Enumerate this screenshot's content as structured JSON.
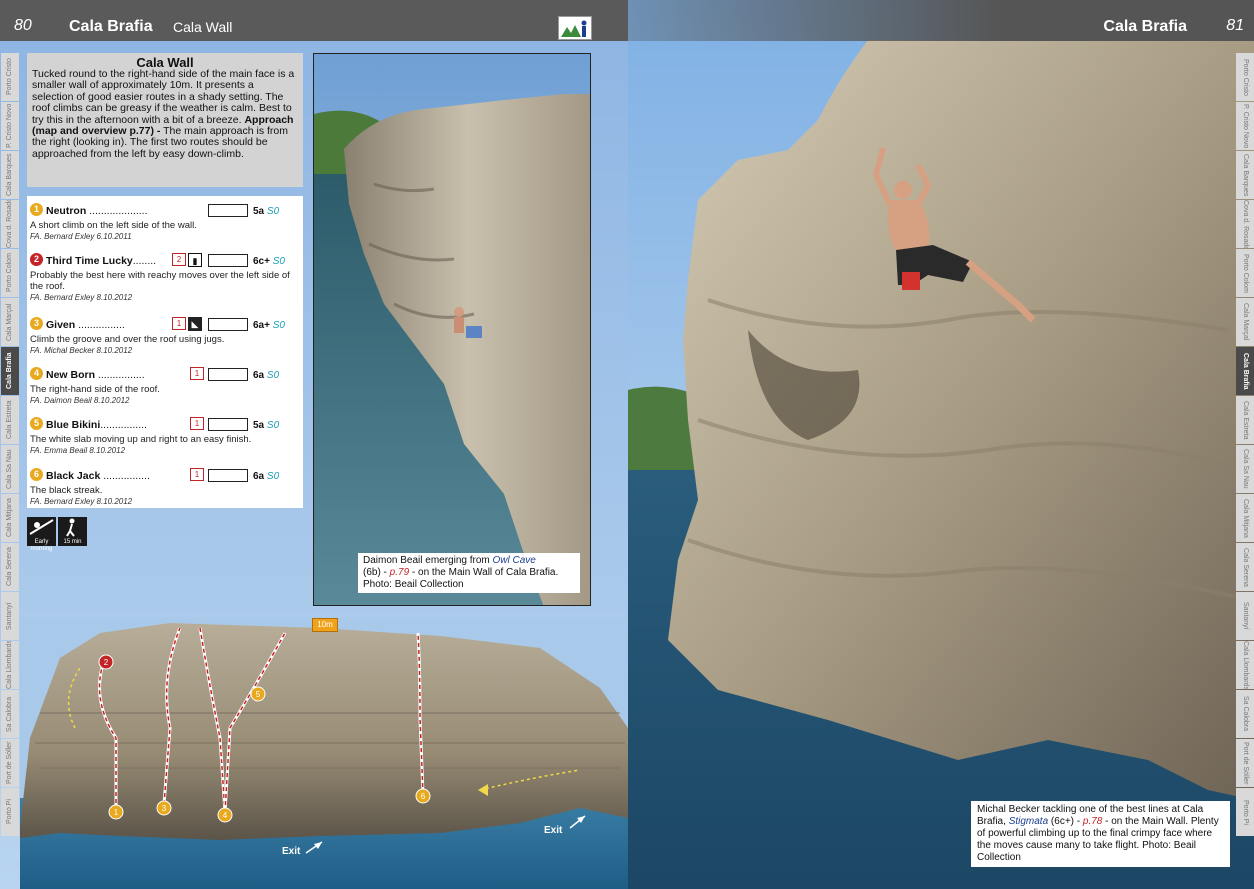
{
  "header": {
    "left_page_number": "80",
    "left_title": "Cala Brafia",
    "left_subtitle": "Cala Wall",
    "right_title": "Cala Brafia",
    "right_page_number": "81"
  },
  "thumb_tabs": [
    "Porto Cristo",
    "P. Cristo Novo",
    "Cala Barques",
    "Cova d. Rosador",
    "Porto Colom",
    "Cala Marçal",
    "Cala Brafia",
    "Cala Estreta",
    "Cala Sa Nau",
    "Cala Mitjana",
    "Cala Serena",
    "Santanyí",
    "Cala Llombards",
    "Sa Calobra",
    "Port de Sóller",
    "Porto Pi"
  ],
  "active_tab": "Cala Brafia",
  "intro": {
    "heading": "Cala Wall",
    "body": "Tucked round to the right-hand side of the main face is a smaller wall of approximately 10m. It presents a selection of good easier routes in a shady setting. The roof climbs can be greasy if the weather is calm. Best to try this in the afternoon with a bit of a breeze.",
    "approach_label": "Approach (map and overview p.77) -",
    "approach_text": " The main approach is from the right (looking in). The first two routes should be approached from the left by easy down-climb."
  },
  "routes": [
    {
      "num": "1",
      "name": "Neutron",
      "dots": " ....................",
      "grade": "5a",
      "s_grade": "S0",
      "desc": "A short climb on the left side of the wall.",
      "fa": "FA. Bernard Exley 6.10.2011"
    },
    {
      "num": "2",
      "name": "Third Time Lucky",
      "dots": "........",
      "grade": "6c+",
      "s_grade": "S0",
      "desc": "Probably the best here with reachy moves over the left side of the roof.",
      "fa": "FA. Bernard Exley 8.10.2012"
    },
    {
      "num": "3",
      "name": "Given",
      "dots": " ................",
      "grade": "6a+",
      "s_grade": "S0",
      "desc": "Climb the groove and over the roof using jugs.",
      "fa": "FA. Michal Becker 8.10.2012"
    },
    {
      "num": "4",
      "name": "New Born",
      "dots": " ................",
      "grade": "6a",
      "s_grade": "S0",
      "desc": "The right-hand side of the roof.",
      "fa": "FA. Daimon Beail 8.10.2012"
    },
    {
      "num": "5",
      "name": "Blue Bikini",
      "dots": "................",
      "grade": "5a",
      "s_grade": "S0",
      "desc": "The white slab moving up and right to an easy finish.",
      "fa": "FA. Emma Beail 8.10.2012"
    },
    {
      "num": "6",
      "name": "Black Jack",
      "dots": " ................",
      "grade": "6a",
      "s_grade": "S0",
      "desc": "The black streak.",
      "fa": "FA. Bernard Exley 8.10.2012"
    }
  ],
  "star_icon": "1",
  "star_icon_2": "2",
  "bottom_icons": {
    "sun_label": "Early morning",
    "walk_label": "15 min"
  },
  "caption1": {
    "prefix": "Daimon Beail emerging from ",
    "route": "Owl Cave",
    "grade": "(6b) - ",
    "page": "p.79",
    "suffix": " - on the Main Wall of Cala Brafia. Photo: Beail Collection"
  },
  "topo": {
    "scale": "10m",
    "exit_label": "Exit"
  },
  "caption2": {
    "prefix": "Michal Becker tackling one of the best lines at Cala Brafia, ",
    "route": "Stigmata",
    "grade": " (6c+) - ",
    "page": "p.78",
    "suffix": " - on the Main Wall. Plenty of powerful climbing up to the final crimpy face where the moves cause many to take flight. Photo: Beail Collection"
  },
  "colors": {
    "header_bg": "#5a5a5a",
    "orange_marker": "#e8a91e",
    "red_marker": "#c42327",
    "s_grade": "#1b9fb4"
  }
}
